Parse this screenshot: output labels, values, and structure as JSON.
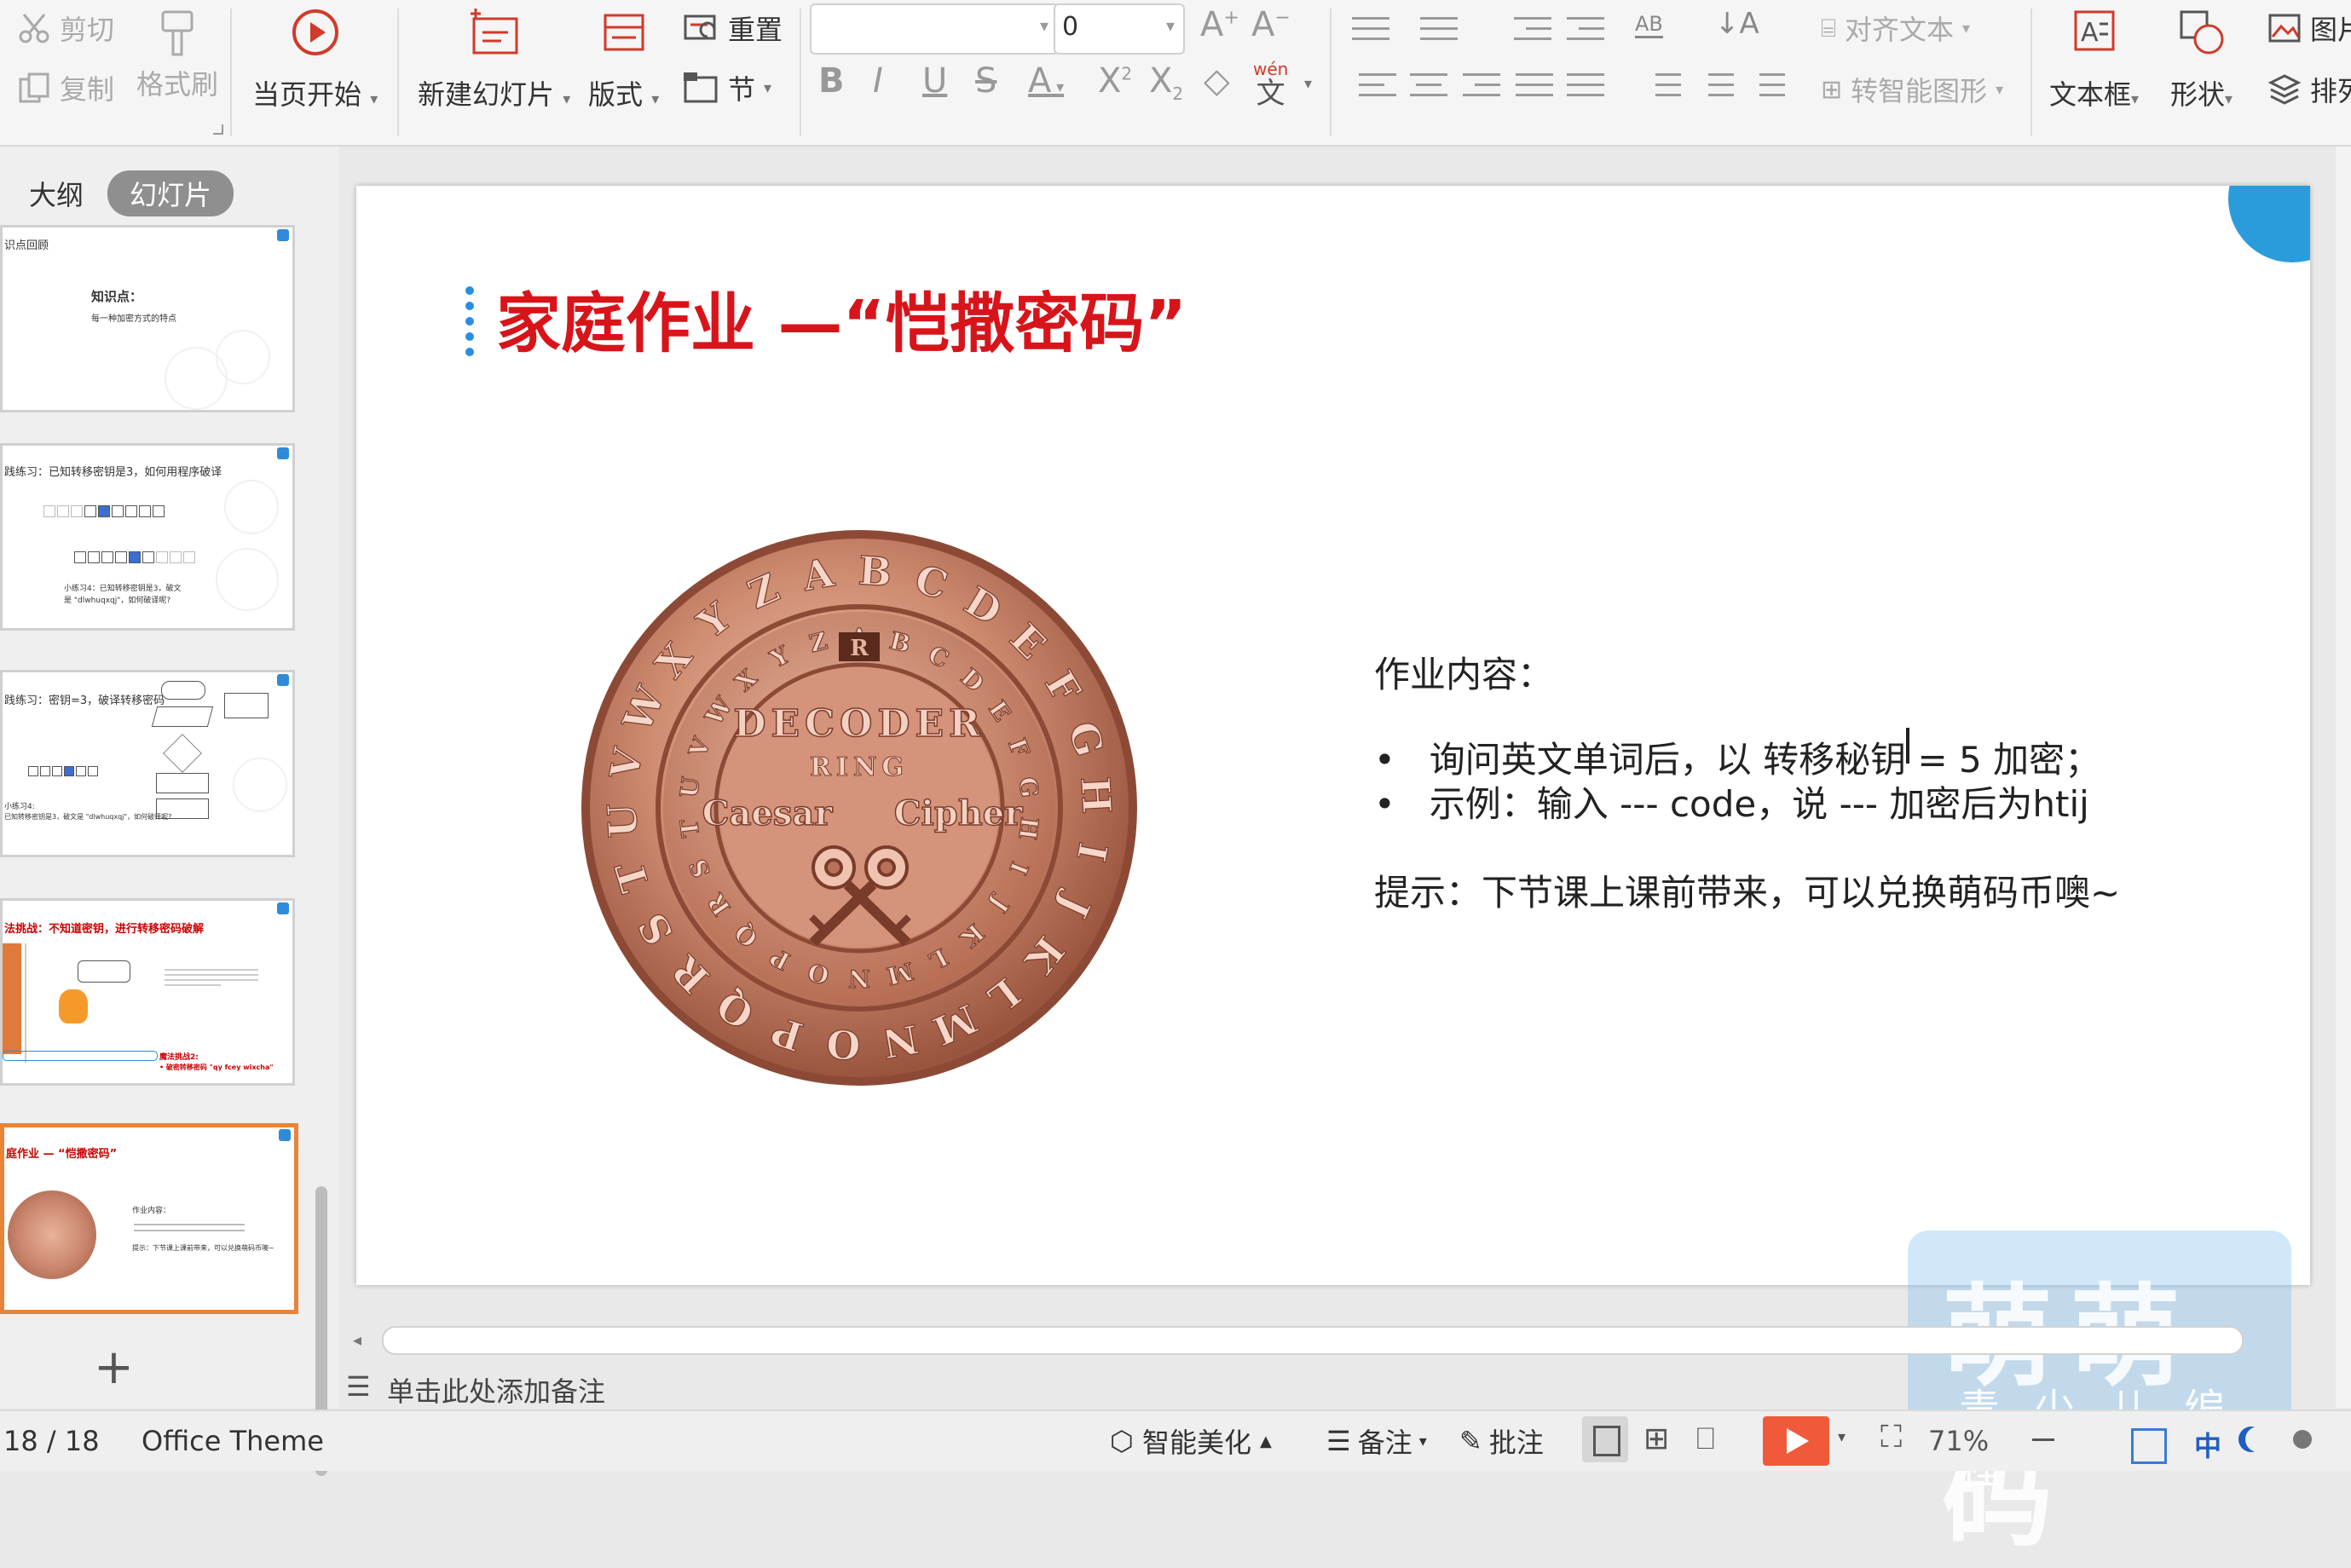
{
  "ribbon": {
    "cut": "剪切",
    "format_painter": "格式刷",
    "copy": "复制",
    "from_current": "当页开始",
    "new_slide": "新建幻灯片",
    "layout": "版式",
    "reset": "重置",
    "section": "节",
    "font_name": "",
    "font_size": "0",
    "align_text": "对齐文本",
    "convert_smartart": "转智能图形",
    "textbox": "文本框",
    "shape": "形状",
    "picture": "图片",
    "arrange": "排列",
    "wen_glyph": "wén",
    "wen_char": "文"
  },
  "left_panel": {
    "tab_outline": "大纲",
    "tab_slides": "幻灯片",
    "thumbs": [
      {
        "title": "识点回顾",
        "line1": "知识点：",
        "line2": "每一种加密方式的特点"
      },
      {
        "title": "践练习：已知转移密钥是3，如何用程序破译",
        "line1": "小练习4：已知转移密钥是3，破文",
        "line2": "是 \"dlwhuqxqj\"，如何破译呢?"
      },
      {
        "title": "践练习：密钥=3，破译转移密码",
        "line1": "小练习4:",
        "line2": "已知转移密钥是3，破文是 \"dlwhuqxqj\"，如何破译呢?"
      },
      {
        "title": "法挑战：不知道密钥，进行转移密码破解",
        "line1": "魔法挑战2:",
        "line2": "• 破密转移密码 \"qy fcey wixcha\""
      },
      {
        "title": "庭作业 — “恺撒密码”",
        "line1": "作业内容：",
        "line2": "提示：下节课上课前带来，可以兑换萌码币噢~"
      }
    ],
    "add_slide": "+"
  },
  "slide": {
    "title": "家庭作业 —“恺撒密码”",
    "heading": "作业内容：",
    "bullets": [
      "询问英文单词后，以 转移秘钥 = 5 加密；",
      "示例：输入 --- code，说 --- 加密后为htij"
    ],
    "hint": "提示：下节课上课前带来，可以兑换萌码币噢~",
    "coin": {
      "outer_letters": "ABCDEFGHIJKLMNOPQRSTUVWXYZ",
      "decoder": "DECODER",
      "ring": "RING",
      "caesar": "Caesar",
      "cipher": "Cipher",
      "window_letter": "R",
      "colors": {
        "copper": "#c9856b",
        "dark": "#8c4a36",
        "light": "#e8b49e"
      }
    }
  },
  "watermark": {
    "big": "萌萌码",
    "small": "青少儿编程"
  },
  "notes_placeholder": "单击此处添加备注",
  "status": {
    "page": "18 / 18",
    "theme": "Office Theme",
    "beautify": "智能美化",
    "notes": "备注",
    "comment": "批注",
    "zoom": "71%",
    "ime": "中"
  },
  "colors": {
    "title_red": "#d8141b",
    "accent_blue": "#2a8ee0",
    "play_orange": "#f05a3a",
    "selected_border": "#e8833a"
  }
}
